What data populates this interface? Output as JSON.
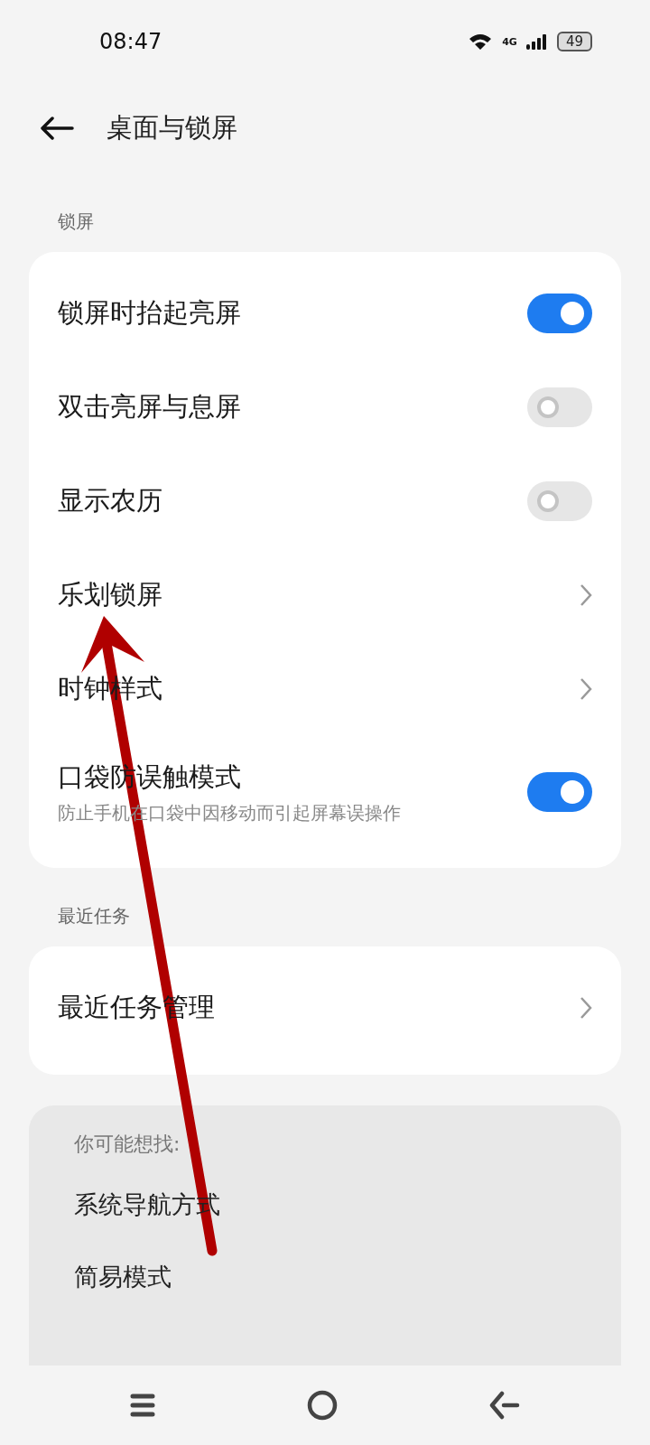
{
  "status_bar": {
    "time": "08:47",
    "network": "4G",
    "battery": "49"
  },
  "header": {
    "title": "桌面与锁屏"
  },
  "sections": [
    {
      "title": "锁屏",
      "items": [
        {
          "kind": "toggle",
          "label": "锁屏时抬起亮屏",
          "on": true
        },
        {
          "kind": "toggle",
          "label": "双击亮屏与息屏",
          "on": false
        },
        {
          "kind": "toggle",
          "label": "显示农历",
          "on": false
        },
        {
          "kind": "link",
          "label": "乐划锁屏"
        },
        {
          "kind": "link",
          "label": "时钟样式"
        },
        {
          "kind": "toggle",
          "label": "口袋防误触模式",
          "subtitle": "防止手机在口袋中因移动而引起屏幕误操作",
          "on": true
        }
      ]
    },
    {
      "title": "最近任务",
      "items": [
        {
          "kind": "link",
          "label": "最近任务管理"
        }
      ]
    }
  ],
  "suggestions": {
    "title": "你可能想找:",
    "items": [
      "系统导航方式",
      "简易模式"
    ]
  }
}
